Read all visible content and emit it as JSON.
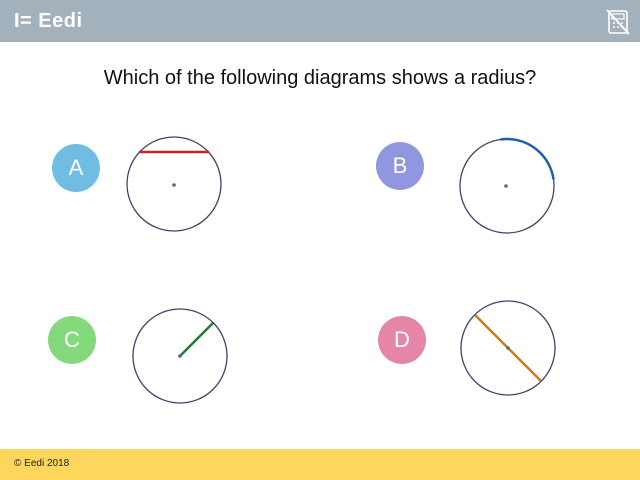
{
  "header": {
    "logo_text": "I= Eedi",
    "calculator_icon": "calculator-disabled-icon"
  },
  "question": {
    "text": "Which of the following diagrams shows a radius?"
  },
  "options": [
    {
      "letter": "A",
      "color": "#6fbde3",
      "line_color": "#cc2222"
    },
    {
      "letter": "B",
      "color": "#9196e0",
      "line_color": "#1f5fb0"
    },
    {
      "letter": "C",
      "color": "#84d97c",
      "line_color": "#1e7d33"
    },
    {
      "letter": "D",
      "color": "#e586a8",
      "line_color": "#cc7a1a"
    }
  ],
  "colors": {
    "header_bg": "#a3b1bd",
    "footer_bg": "#fdd65b",
    "circle_stroke": "#4a3d6b"
  },
  "footer": {
    "copyright": "© Eedi 2018"
  }
}
